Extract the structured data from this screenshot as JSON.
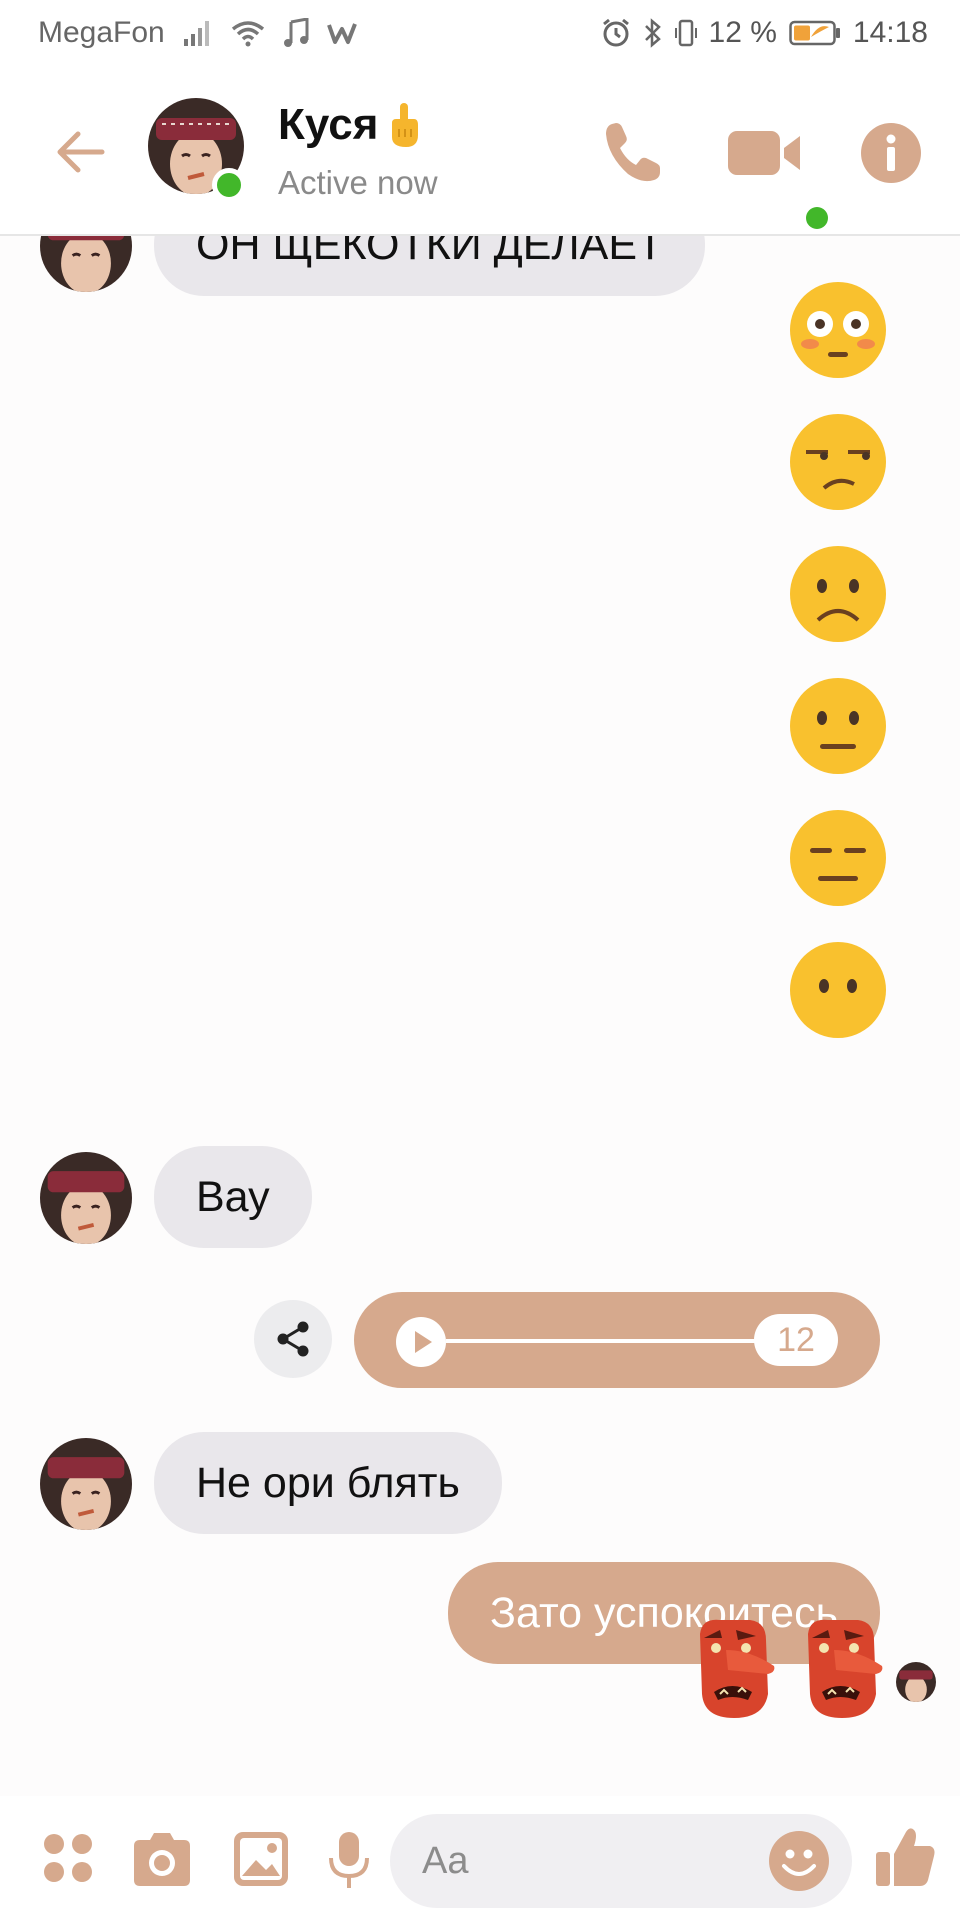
{
  "status_bar": {
    "carrier": "MegaFon",
    "battery_percent": "12 %",
    "time": "14:18",
    "icons": [
      "signal-icon",
      "wifi-icon",
      "music-icon",
      "w-app-icon",
      "alarm-icon",
      "bluetooth-icon",
      "vibrate-icon",
      "battery-icon"
    ]
  },
  "header": {
    "contact_name": "Куся",
    "name_emoji_icon": "middle-finger-icon",
    "status": "Active now",
    "icons": [
      "back-arrow-icon",
      "phone-icon",
      "video-camera-icon",
      "info-icon"
    ]
  },
  "messages": [
    {
      "direction": "incoming",
      "type": "text",
      "text": "ОН ЩЕКОТКИ ДЕЛАЕТ"
    },
    {
      "direction": "outgoing",
      "type": "emoji",
      "icon": "flushed-face-icon"
    },
    {
      "direction": "outgoing",
      "type": "emoji",
      "icon": "unamused-face-icon"
    },
    {
      "direction": "outgoing",
      "type": "emoji",
      "icon": "frowning-face-icon"
    },
    {
      "direction": "outgoing",
      "type": "emoji",
      "icon": "neutral-face-icon"
    },
    {
      "direction": "outgoing",
      "type": "emoji",
      "icon": "expressionless-face-icon"
    },
    {
      "direction": "outgoing",
      "type": "emoji",
      "icon": "face-without-mouth-icon"
    },
    {
      "direction": "incoming",
      "type": "text",
      "text": "Вау"
    },
    {
      "direction": "outgoing",
      "type": "voice",
      "duration": "12"
    },
    {
      "direction": "incoming",
      "type": "text",
      "text": "Не ори блять"
    },
    {
      "direction": "outgoing",
      "type": "text",
      "text": "Зато успокоитесь"
    },
    {
      "direction": "outgoing",
      "type": "sticker",
      "icons": [
        "goblin-mask-icon",
        "goblin-mask-icon"
      ]
    }
  ],
  "composer": {
    "placeholder": "Aa",
    "icons": [
      "apps-icon",
      "camera-icon",
      "gallery-icon",
      "microphone-icon",
      "emoji-icon",
      "thumbs-up-icon"
    ]
  },
  "colors": {
    "accent": "#d6a98d",
    "incoming_bubble": "#e9e7eb",
    "online": "#42b72a"
  }
}
